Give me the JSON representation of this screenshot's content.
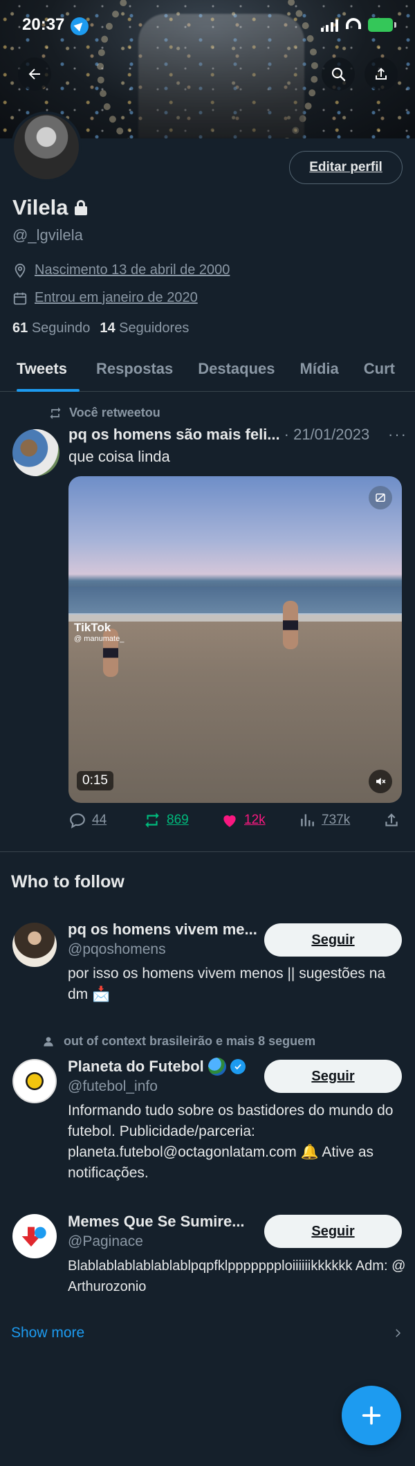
{
  "status_bar": {
    "time": "20:37"
  },
  "profile": {
    "edit_label": "Editar perfil",
    "name": "Vilela",
    "handle": "@_lgvilela",
    "birth": "Nascimento 13 de abril de 2000",
    "joined": "Entrou em janeiro de 2020",
    "following_count": "61",
    "following_label": "Seguindo",
    "followers_count": "14",
    "followers_label": "Seguidores"
  },
  "tabs": [
    {
      "label": "Tweets",
      "active": true
    },
    {
      "label": "Respostas"
    },
    {
      "label": "Destaques"
    },
    {
      "label": "Mídia"
    },
    {
      "label": "Curt"
    }
  ],
  "tweet": {
    "retweet_label": "Você retweetou",
    "author": "pq os homens são mais feli...",
    "date": "· 21/01/2023",
    "more": "···",
    "text": "que coisa linda",
    "media": {
      "watermark": "TikTok",
      "watermark_user": "@ manumate_",
      "duration": "0:15"
    },
    "stats": {
      "replies": "44",
      "retweets": "869",
      "likes": "12k",
      "views": "737k"
    }
  },
  "who_to_follow": {
    "title": "Who to follow",
    "follow_label": "Seguir",
    "accounts": [
      {
        "name": "pq os homens vivem me...",
        "handle": "@pqoshomens",
        "bio": "por isso os homens vivem menos || sugestões na dm 📩"
      },
      {
        "context": "out of context brasileirão e mais 8 seguem",
        "name": "Planeta do Futebol",
        "handle": "@futebol_info",
        "bio": "Informando tudo sobre os bastidores do mundo do futebol. Publicidade/parceria: planeta.futebol@octagonlatam.com 🔔 Ative as notificações."
      },
      {
        "name": "Memes Que Se Sumire...",
        "handle": "@Paginace",
        "bio": "Blablablablablablablpqpfklppppppploiiiiiikkkkkk Adm: @Arthurozonio"
      }
    ],
    "show_more": "Show more"
  },
  "colors": {
    "background": "#15202b",
    "accent": "#1d9bf0",
    "retweet_green": "#00ba7c",
    "like_pink": "#f91880",
    "muted": "#8b98a5"
  }
}
